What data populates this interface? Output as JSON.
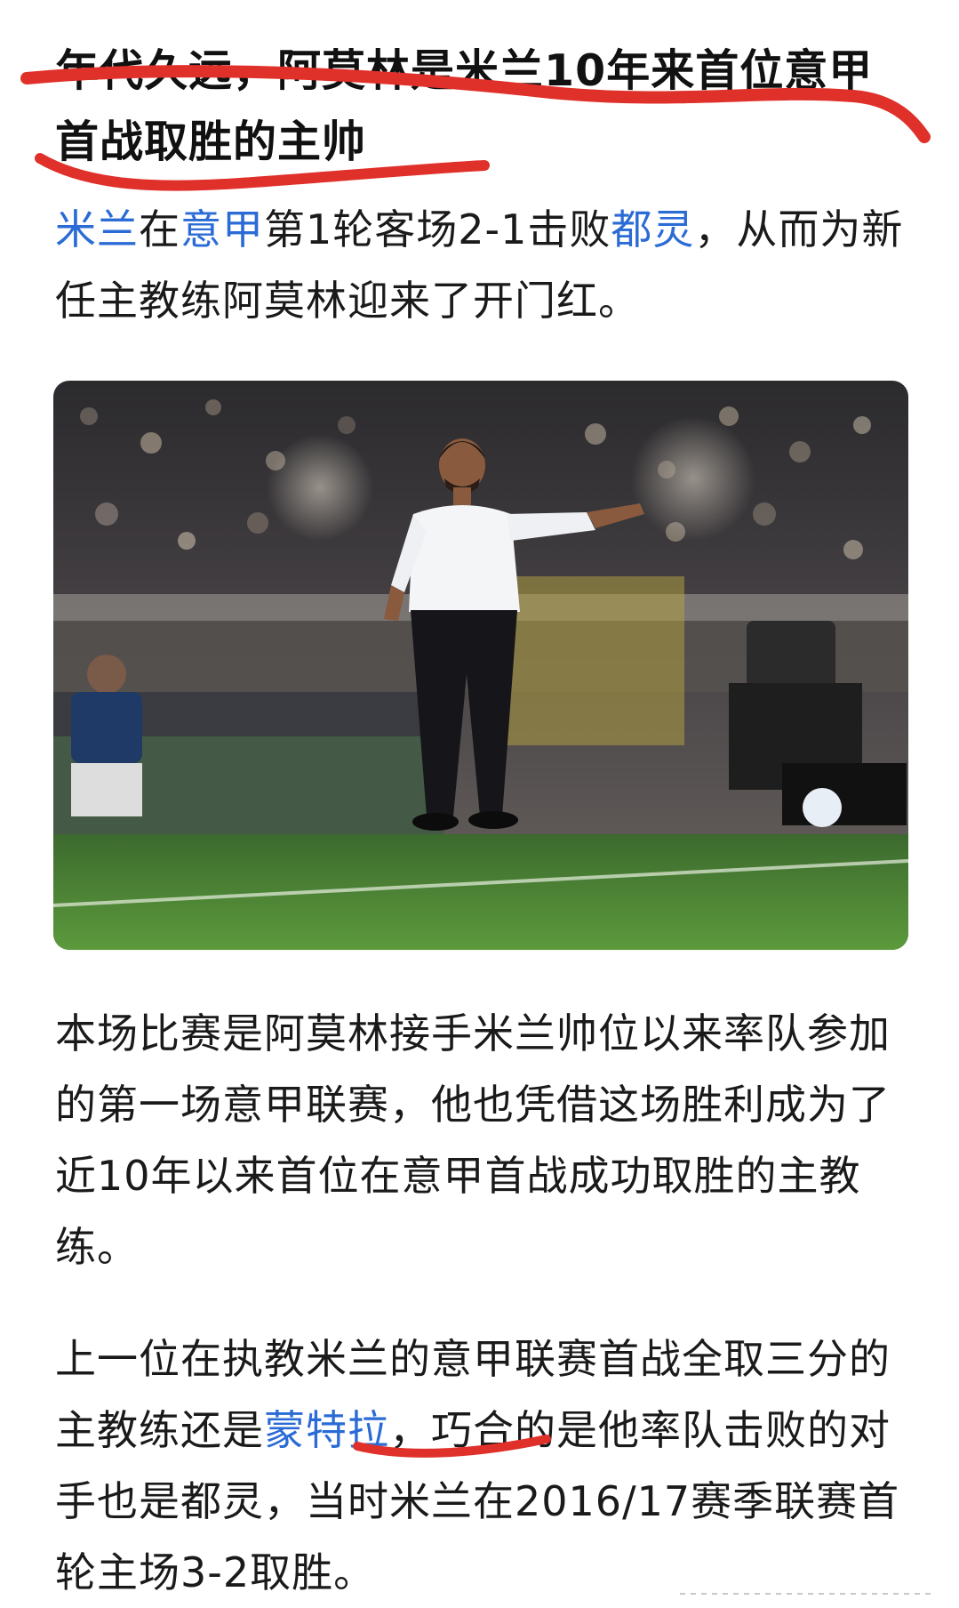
{
  "headline": "年代久远，阿莫林是米兰10年来首位意甲首战取胜的主帅",
  "para1": {
    "link1": "米兰",
    "text1": "在",
    "link2": "意甲",
    "text2": "第1轮客场2-1击败",
    "link3": "都灵",
    "text3": "，从而为新任主教练阿莫林迎来了开门红。"
  },
  "photo": {
    "icon": "coach-on-sideline-photo"
  },
  "para2": "本场比赛是阿莫林接手米兰帅位以来率队参加的第一场意甲联赛，他也凭借这场胜利成为了近10年以来首位在意甲首战成功取胜的主教练。",
  "para3": {
    "text1": "上一位在执教米兰的意甲联赛首战全取三分的主教练还是",
    "link1": "蒙特拉",
    "text2": "，巧合的是他率队击败的对手也是都灵，当时米兰在2016/17赛季联赛首轮主场3-2取胜。"
  },
  "colors": {
    "link": "#2a6bd6",
    "annotation": "#e0302a",
    "text": "#1a1a1a"
  }
}
